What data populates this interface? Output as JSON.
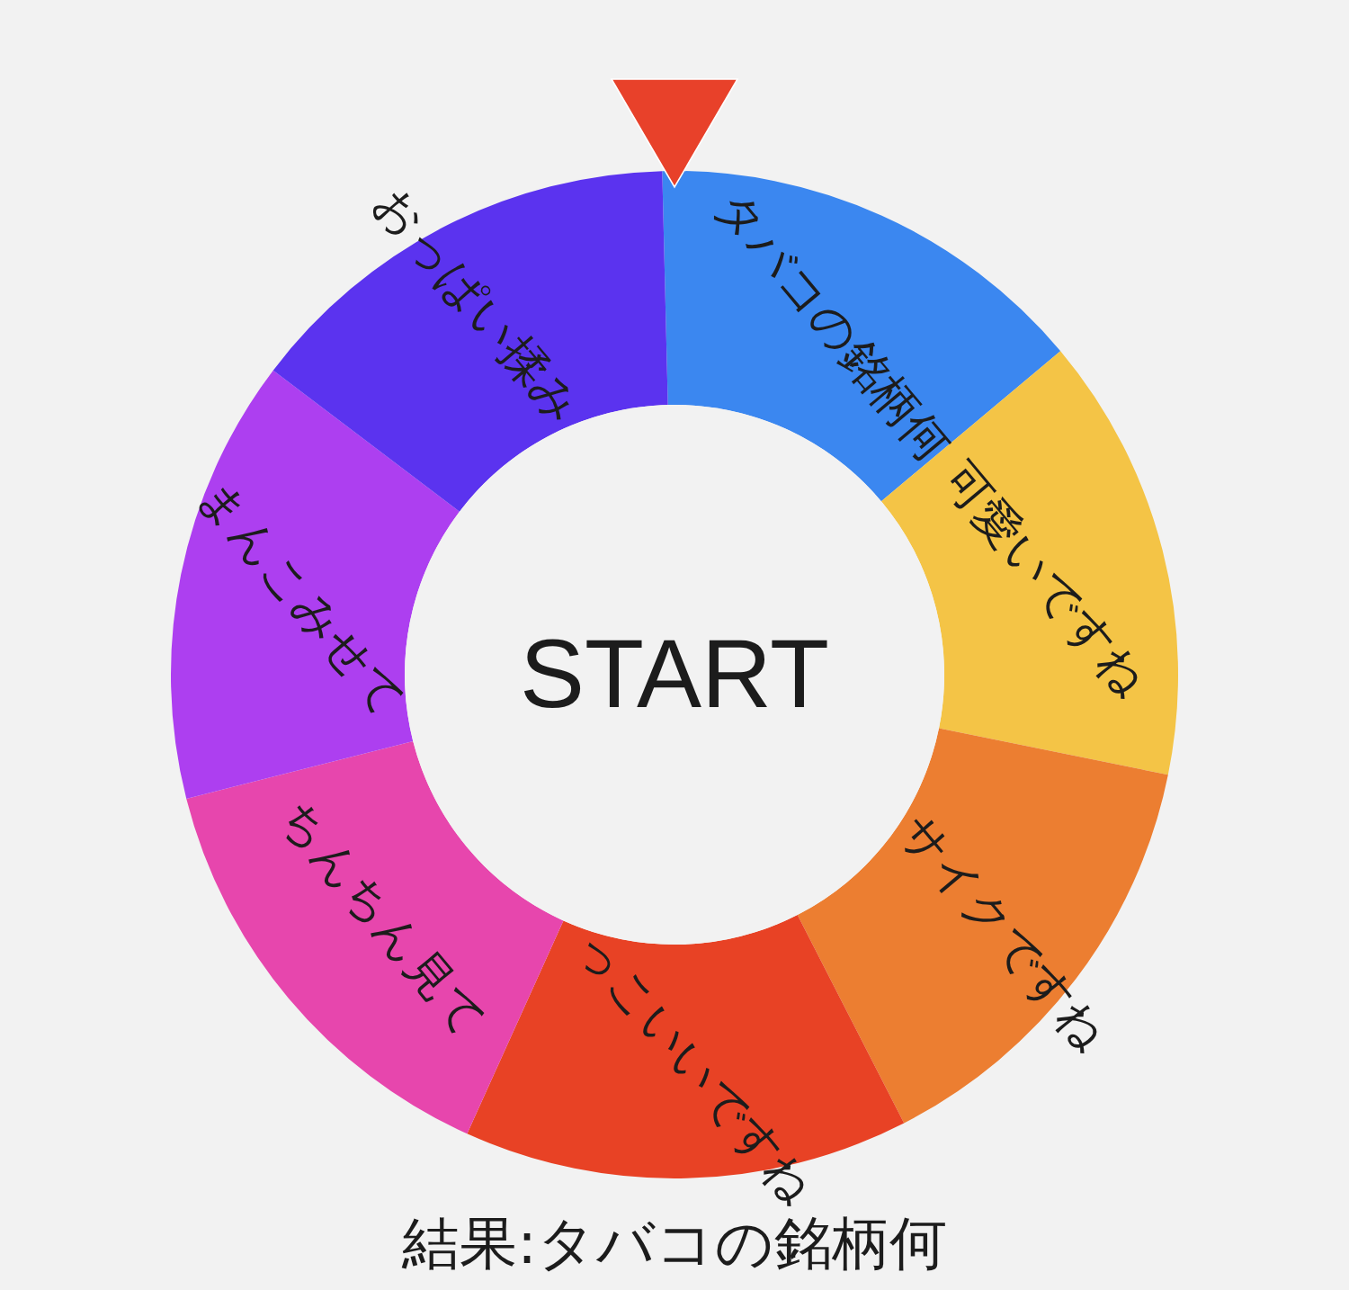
{
  "wheel": {
    "segments": [
      {
        "label": "タバコの銘柄何",
        "color": "#3b87f0"
      },
      {
        "label": "可愛いですね",
        "color": "#f4c446"
      },
      {
        "label": "サイクですね",
        "color": "#ec7e31"
      },
      {
        "label": "っこいいですね",
        "color": "#e84225"
      },
      {
        "label": "ちんちん見て",
        "color": "#e746ad"
      },
      {
        "label": "まんこみせて",
        "color": "#ad3ff0"
      },
      {
        "label": "おっぱい揉み",
        "color": "#5b33ef"
      }
    ],
    "start_button": "START"
  },
  "result": "結果:タバコの銘柄何"
}
